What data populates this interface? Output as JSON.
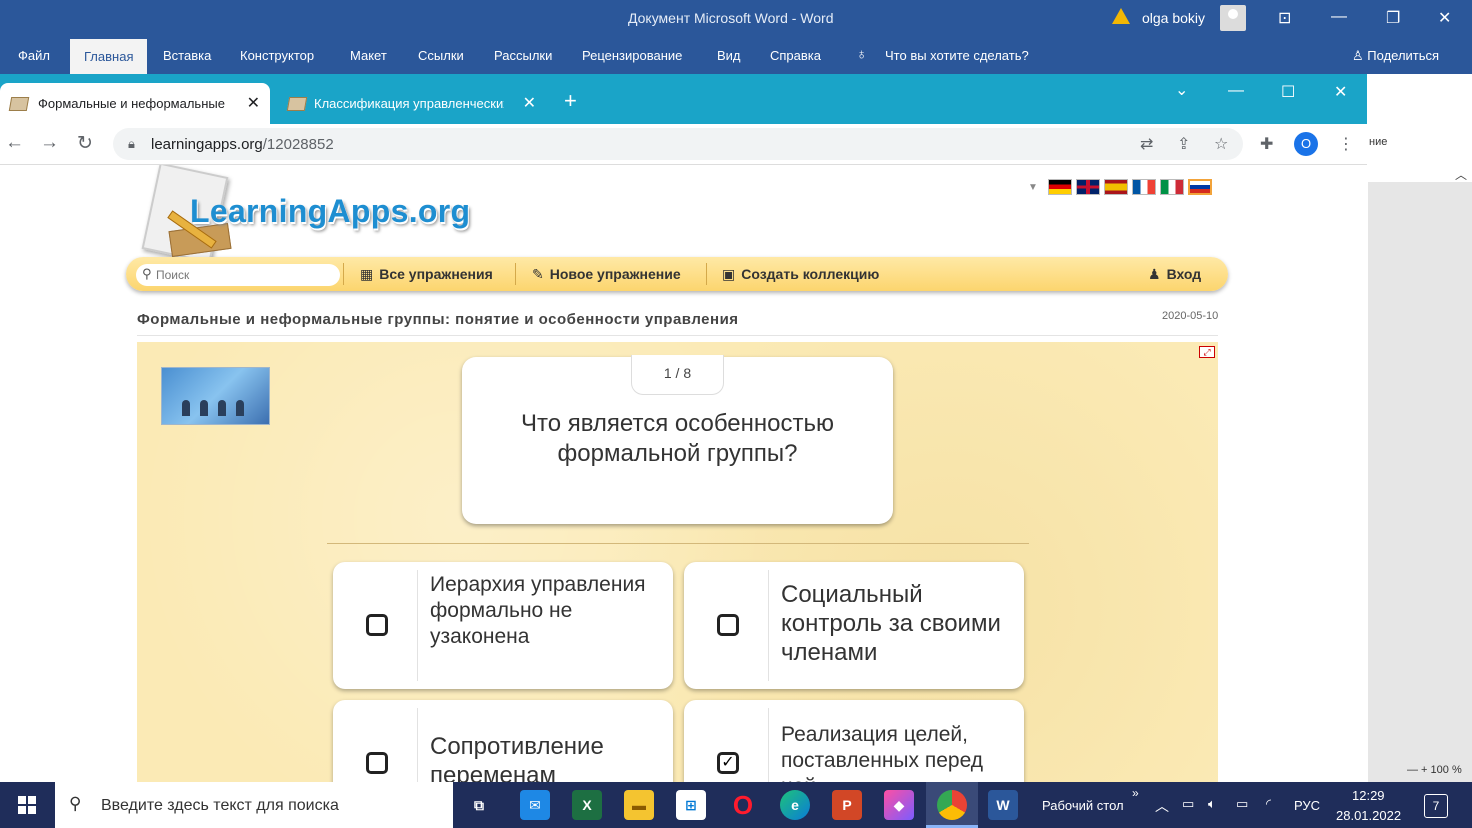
{
  "word": {
    "title": "Документ Microsoft Word  -  Word",
    "user": "olga bokiy",
    "tabs": [
      "Файл",
      "Главная",
      "Вставка",
      "Конструктор",
      "Макет",
      "Ссылки",
      "Рассылки",
      "Рецензирование",
      "Вид",
      "Справка"
    ],
    "tell_me": "Что вы хотите сделать?",
    "share": "Поделиться",
    "side_text": "ние",
    "zoom": "100 %"
  },
  "browser": {
    "tabs": [
      {
        "title": "Формальные и неформальные"
      },
      {
        "title": "Классификация управленческих"
      }
    ],
    "url_domain": "learningapps.org",
    "url_path": "/12028852",
    "profile_initial": "O"
  },
  "site": {
    "logo": "LearningApps.org",
    "search_placeholder": "Поиск",
    "nav": {
      "all": "Все упражнения",
      "new": "Новое упражнение",
      "collection": "Создать коллекцию",
      "login": "Вход"
    },
    "exercise_title": "Формальные и неформальные группы: понятие и особенности управления",
    "date": "2020-05-10"
  },
  "quiz": {
    "counter": "1 / 8",
    "question": "Что является особенностью формальной группы?",
    "answers": [
      {
        "text": "Иерархия управления формально не узаконена",
        "checked": false
      },
      {
        "text": "Социальный контроль за своими членами",
        "checked": false
      },
      {
        "text": "Сопротивление переменам",
        "checked": false
      },
      {
        "text": "Реализация целей, поставленных перед ней",
        "checked": true
      }
    ]
  },
  "taskbar": {
    "search": "Введите здесь текст для поиска",
    "desktop": "Рабочий стол",
    "lang": "РУС",
    "time": "12:29",
    "date": "28.01.2022",
    "notifications": "7"
  }
}
